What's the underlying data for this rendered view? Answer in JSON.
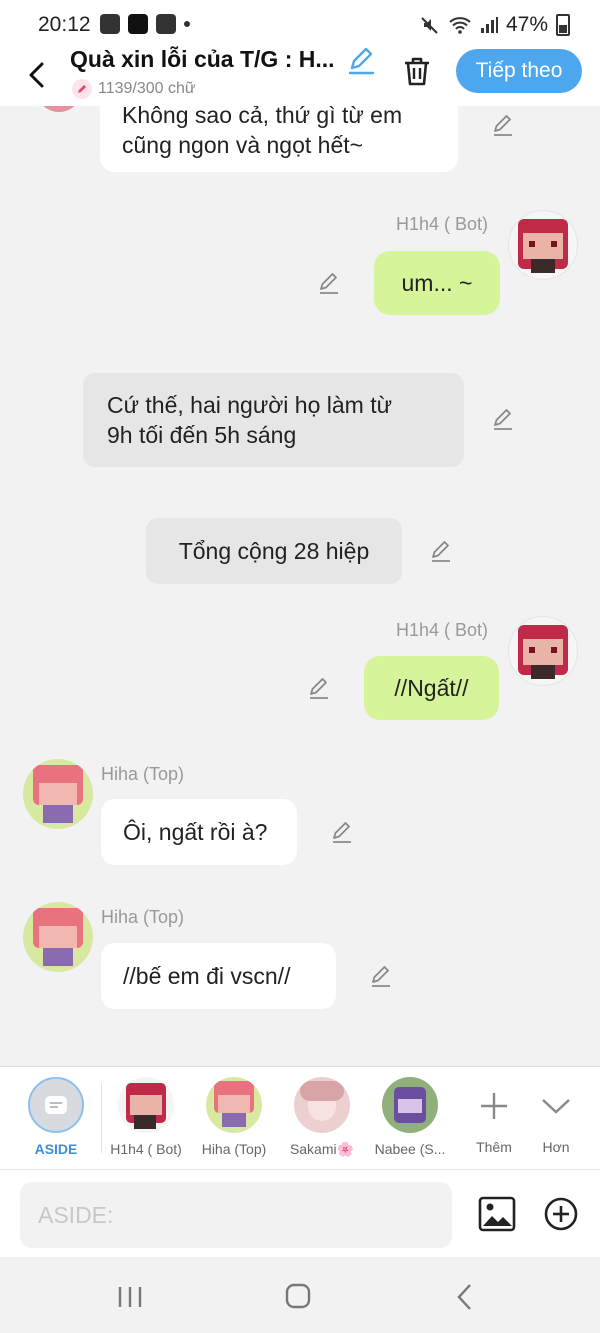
{
  "status": {
    "time": "20:12",
    "battery": "47%"
  },
  "header": {
    "title": "Quà xin lỗi của T/G : H...",
    "counter": "1139/300 chữ",
    "next_label": "Tiếp theo"
  },
  "messages": [
    {
      "kind": "left",
      "text_line1": "Không sao cả, thứ gì từ em",
      "text_line2": "cũng ngon và ngọt hết~"
    },
    {
      "kind": "right",
      "sender": "H1h4 ( Bot)",
      "text": "um... ~"
    },
    {
      "kind": "aside",
      "text_line1": "Cứ thế, hai người họ làm từ",
      "text_line2": "9h tối đến 5h sáng"
    },
    {
      "kind": "aside",
      "text": "Tổng cộng 28 hiệp"
    },
    {
      "kind": "right",
      "sender": "H1h4 ( Bot)",
      "text": "//Ngất//"
    },
    {
      "kind": "left",
      "sender": "Hiha (Top)",
      "text": "Ôi, ngất rồi à?"
    },
    {
      "kind": "left",
      "sender": "Hiha (Top)",
      "text": "//bế em đi vscn//"
    }
  ],
  "tray": {
    "aside_label": "ASIDE",
    "characters": [
      "H1h4 ( Bot)",
      "Hiha (Top)",
      "Sakami🌸",
      "Nabee (S..."
    ],
    "more_label": "Thêm",
    "collapse_label": "Hơn"
  },
  "composer": {
    "placeholder": "ASIDE:"
  },
  "colors": {
    "accent": "#4da7ef",
    "bot_bubble": "#d6f59a",
    "aside_bubble": "#e6e6e6"
  }
}
